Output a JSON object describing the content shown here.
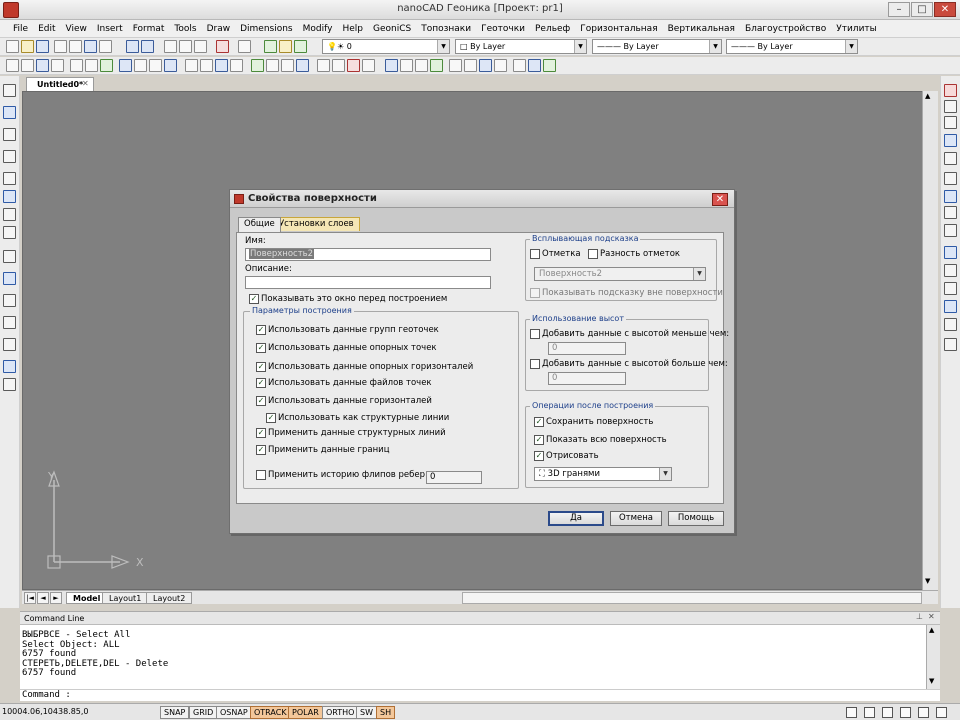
{
  "window": {
    "title": "nanoCAD Геоника [Проект: pr1]"
  },
  "menu": [
    "File",
    "Edit",
    "View",
    "Insert",
    "Format",
    "Tools",
    "Draw",
    "Dimensions",
    "Modify",
    "Help",
    "GeoniCS",
    "Топознаки",
    "Геоточки",
    "Рельеф",
    "Горизонтальная",
    "Вертикальная",
    "Благоустройство",
    "Утилиты"
  ],
  "layer_bar": {
    "layer_value": "0",
    "color_value": "By Layer",
    "linetype_value": "By Layer",
    "lineweight_value": "By Layer"
  },
  "document": {
    "tab_title": "Untitled0*",
    "layout_tabs": [
      "Model",
      "Layout1",
      "Layout2"
    ]
  },
  "ucs": {
    "x_label": "X",
    "y_label": "Y"
  },
  "dialog": {
    "title": "Свойства поверхности",
    "tabs": [
      "Общие",
      "Установки слоев"
    ],
    "name_label": "Имя:",
    "name_value": "Поверхность2",
    "desc_label": "Описание:",
    "desc_value": "",
    "show_before_label": "Показывать это окно перед построением",
    "build_group_title": "Параметры построения",
    "build_options": [
      {
        "label": "Использовать данные групп геоточек",
        "checked": true
      },
      {
        "label": "Использовать данные опорных точек",
        "checked": true
      },
      {
        "label": "Использовать данные опорных горизонталей",
        "checked": true
      },
      {
        "label": "Использовать данные файлов точек",
        "checked": true
      },
      {
        "label": "Использовать данные горизонталей",
        "checked": true
      },
      {
        "label": "Использовать как структурные линии",
        "checked": true
      },
      {
        "label": "Применить данные структурных линий",
        "checked": true
      },
      {
        "label": "Применить данные границ",
        "checked": true
      },
      {
        "label": "Применить историю флипов ребер",
        "checked": false
      }
    ],
    "flip_history_value": "0",
    "tooltip_group_title": "Всплывающая подсказка",
    "tooltip_mark_label": "Отметка",
    "tooltip_diff_label": "Разность отметок",
    "tooltip_surface_value": "Поверхность2",
    "tooltip_outside_label": "Показывать подсказку вне поверхности",
    "heights_group_title": "Использование высот",
    "add_lower_label": "Добавить данные с высотой меньше чем:",
    "add_lower_value": "0",
    "add_higher_label": "Добавить данные с высотой больше чем:",
    "add_higher_value": "0",
    "after_group_title": "Операции после построения",
    "save_surface_label": "Сохранить поверхность",
    "show_whole_label": "Показать всю поверхность",
    "draw_label": "Отрисовать",
    "draw_mode_value": "3D гранями",
    "ok_label": "Да",
    "cancel_label": "Отмена",
    "help_label": "Помощь"
  },
  "command": {
    "header": "Command Line",
    "history": [
      "ВЫБРВСЕ - Select All",
      "Select Object: ALL",
      "6757 found",
      "СТЕРЕТЬ,DELETE,DEL - Delete",
      "6757 found"
    ],
    "prompt": "Command :"
  },
  "status": {
    "coords": "10004.06,10438.85,0",
    "toggles": [
      {
        "label": "SNAP",
        "on": false
      },
      {
        "label": "GRID",
        "on": false
      },
      {
        "label": "OSNAP",
        "on": false
      },
      {
        "label": "OTRACK",
        "on": true
      },
      {
        "label": "POLAR",
        "on": true
      },
      {
        "label": "ORTHO",
        "on": false
      },
      {
        "label": "SW",
        "on": false
      },
      {
        "label": "SH",
        "on": true
      }
    ]
  },
  "colors": {
    "canvas": "#808080",
    "dialog_bg": "#ececec",
    "group_title": "#1d3f8a",
    "status_on": "#f3c79a"
  }
}
